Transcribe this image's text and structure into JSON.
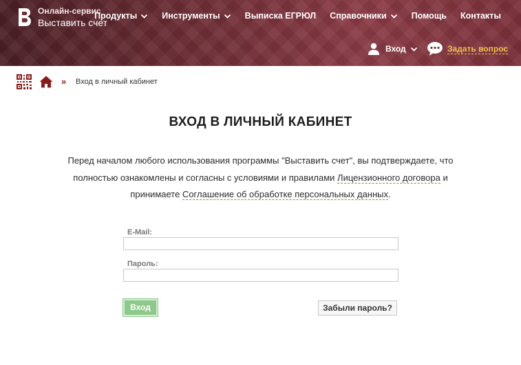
{
  "brand": {
    "top": "Онлайн-сервис",
    "main": "Выставить счет"
  },
  "nav": [
    {
      "label": "Продукты",
      "dropdown": true
    },
    {
      "label": "Инструменты",
      "dropdown": true
    },
    {
      "label": "Выписка ЕГРЮЛ",
      "dropdown": false
    },
    {
      "label": "Справочники",
      "dropdown": true
    },
    {
      "label": "Помощь",
      "dropdown": false
    },
    {
      "label": "Контакты",
      "dropdown": false
    }
  ],
  "header": {
    "login_label": "Вход",
    "ask_label": "Задать вопрос"
  },
  "breadcrumb": {
    "separator": "»",
    "current": "Вход в личный кабинет"
  },
  "page": {
    "title": "ВХОД В ЛИЧНЫЙ КАБИНЕТ",
    "intro_1": "Перед началом любого использования программы \"Выставить счет\", вы подтверждаете, что полностью ознакомлены и согласны с условиями и правилами ",
    "link_license": "Лицензионного договора",
    "intro_2": " и принимаете ",
    "link_privacy": "Соглашение об обработке персональных данных",
    "intro_3": "."
  },
  "form": {
    "email_label": "E-Mail:",
    "email_value": "",
    "password_label": "Пароль:",
    "password_value": "",
    "submit_label": "Вход",
    "forgot_label": "Забыли пароль?"
  },
  "colors": {
    "header": "#6e2e35",
    "accent": "#f2c14e",
    "submit": "#8cc98a",
    "breadcrumb": "#8b1a1a"
  }
}
